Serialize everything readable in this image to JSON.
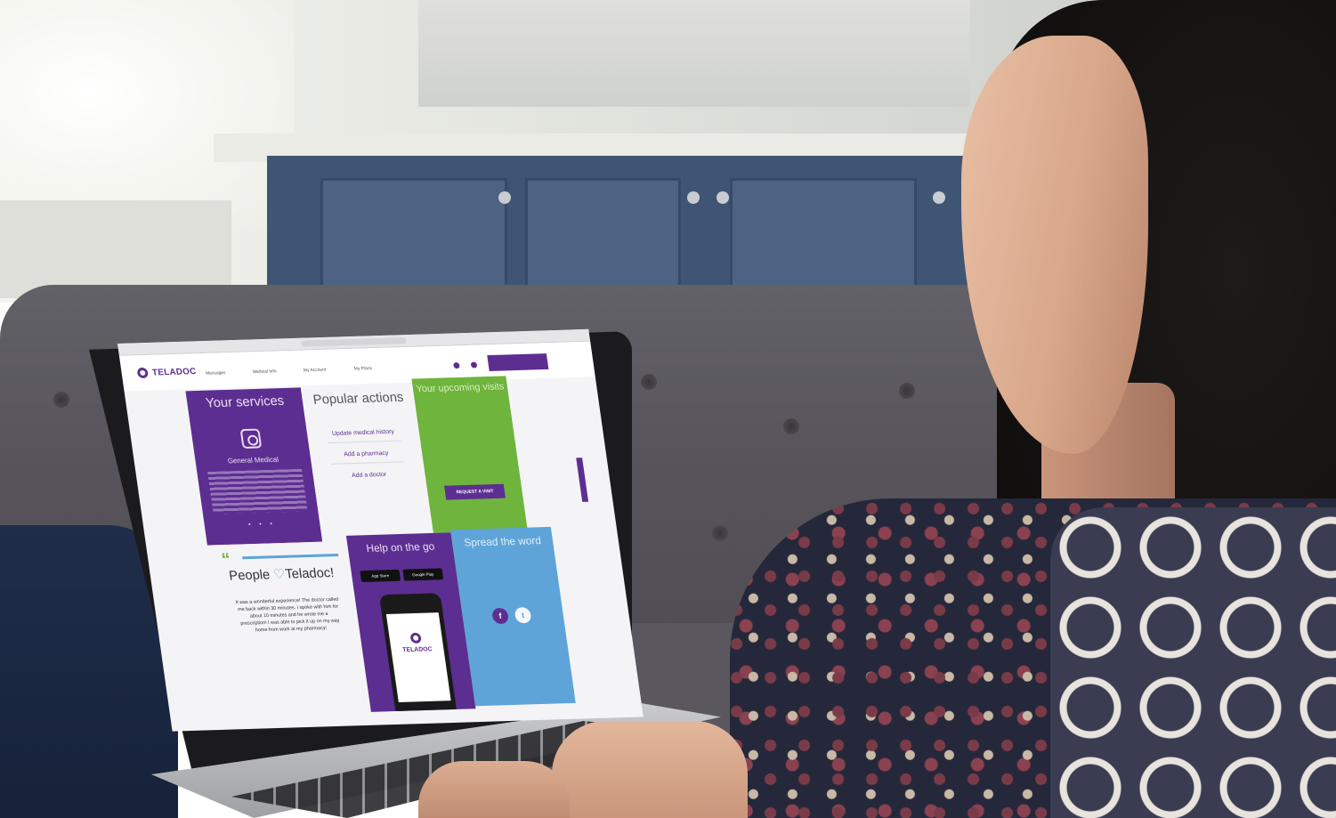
{
  "site": {
    "logo": "TELADOC",
    "nav": [
      "Messages",
      "Medical Info",
      "My Account",
      "My Plans"
    ],
    "visit_button": "Request a visit"
  },
  "tiles": {
    "services": {
      "title": "Your services",
      "item": "General Medical",
      "dots": "• • •"
    },
    "actions": {
      "title": "Popular actions",
      "links": [
        "Update medical history",
        "Add a pharmacy",
        "Add a doctor"
      ]
    },
    "visits": {
      "title": "Your upcoming visits",
      "button": "REQUEST A VISIT"
    },
    "people": {
      "quote_mark": "“",
      "title_prefix": "People ",
      "heart": "♡",
      "title_suffix": "Teladoc!",
      "testimonial": "It was a wonderful experience! The doctor called me back within 30 minutes. I spoke with him for about 10 minutes and he wrote me a prescription! I was able to pick it up on my way home from work at my pharmacy!"
    },
    "help": {
      "title": "Help on the go",
      "app_store": "App Store",
      "google_play": "Google Play",
      "phone_logo": "TELADOC"
    },
    "spread": {
      "title": "Spread the word",
      "facebook": "f",
      "twitter": "t"
    }
  },
  "colors": {
    "brand_purple": "#5d2e91",
    "green": "#6fb43c",
    "blue": "#5ea4d8"
  }
}
